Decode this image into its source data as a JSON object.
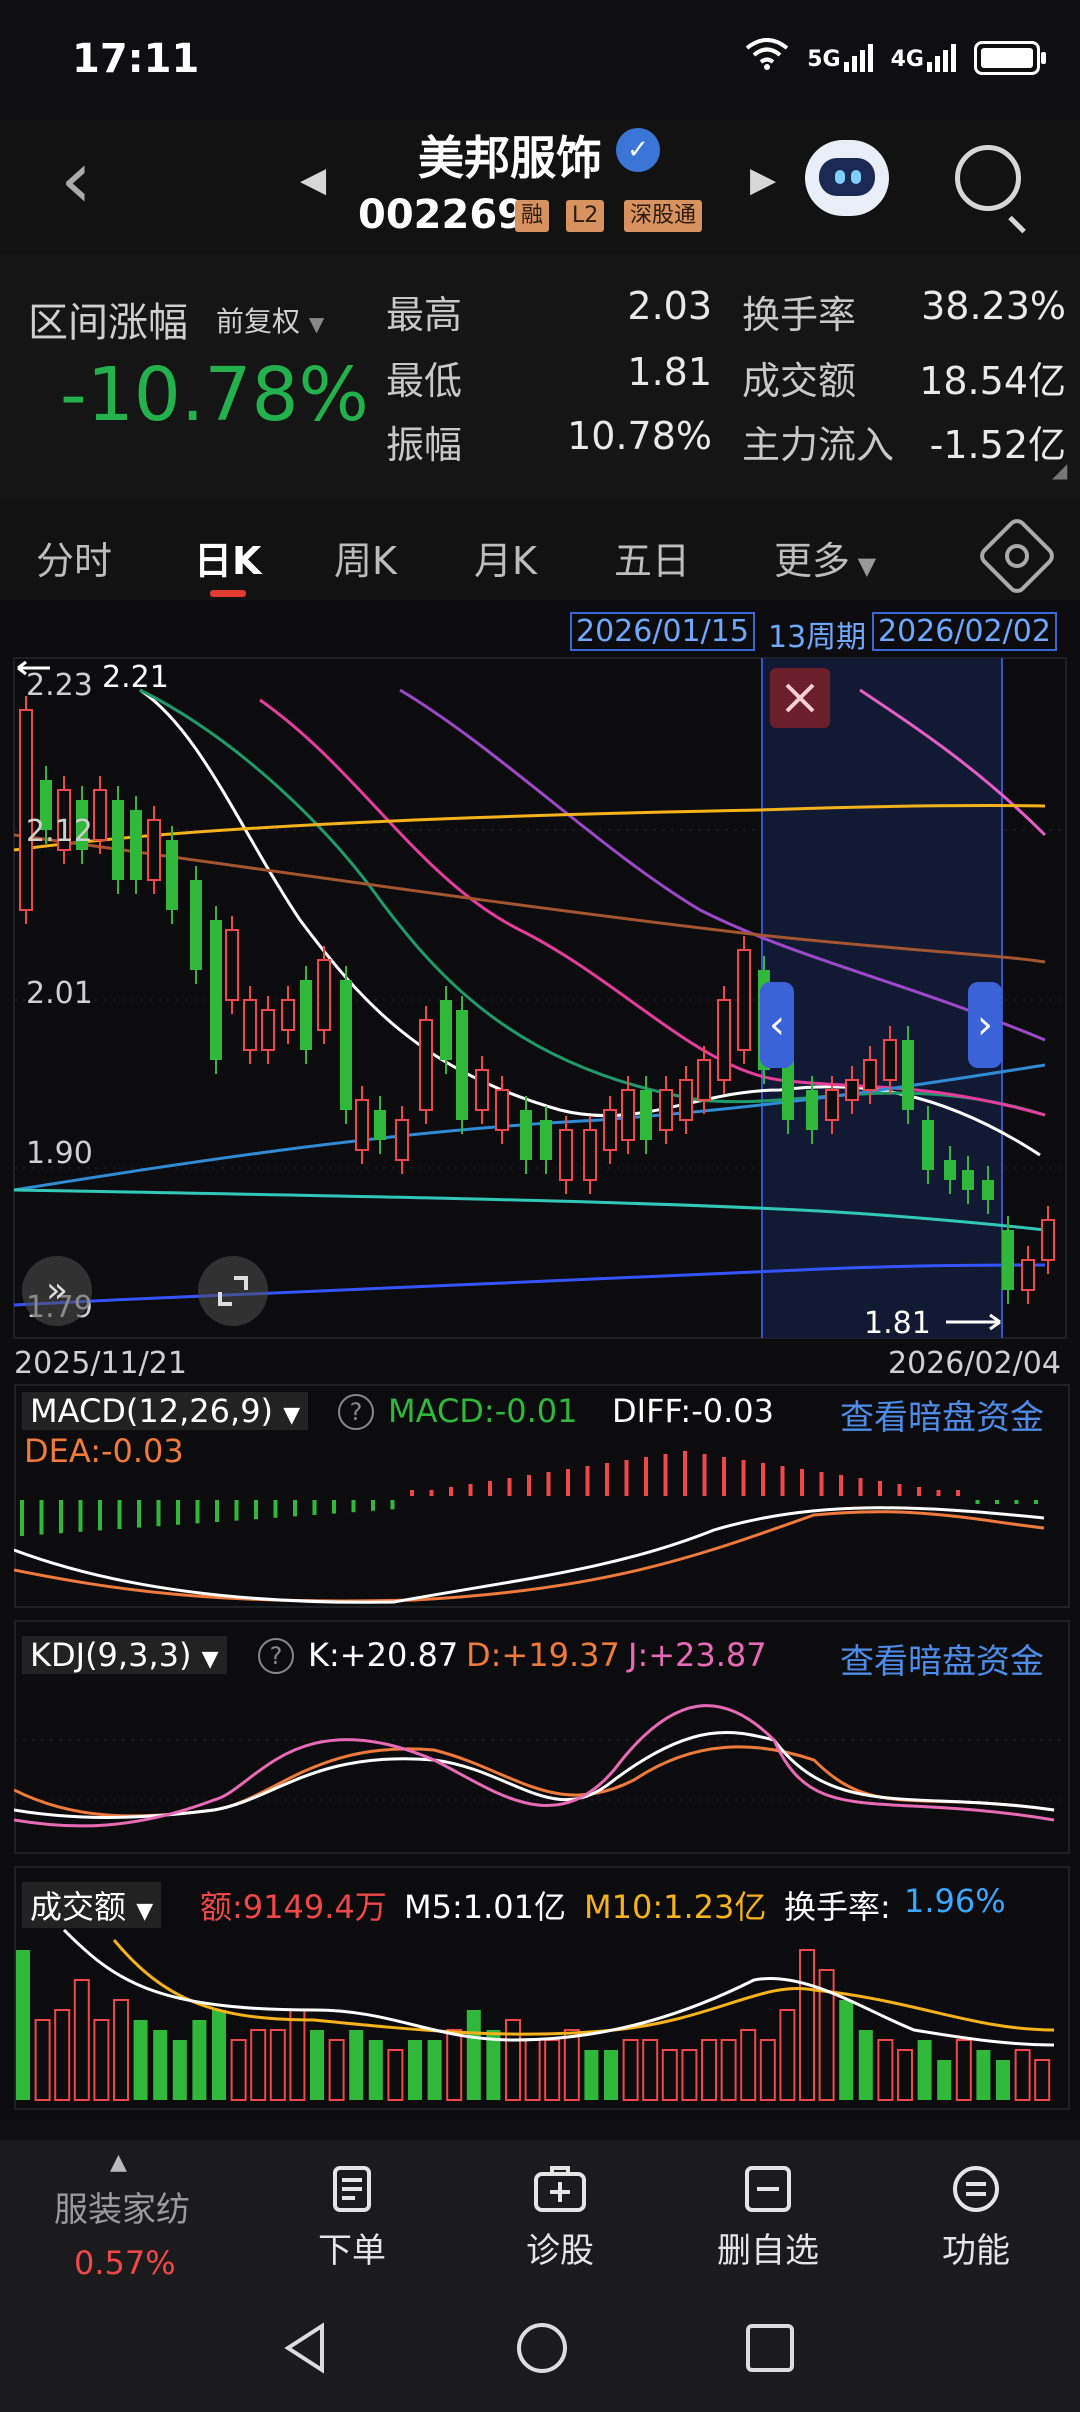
{
  "status_bar": {
    "time": "17:11",
    "net1": "5G",
    "net2": "4G"
  },
  "stock": {
    "name": "美邦服饰",
    "code": "002269",
    "tags": [
      "融",
      "L2",
      "深股通"
    ]
  },
  "quote": {
    "range_label": "区间涨幅",
    "adjust_label": "前复权",
    "range_change": "-10.78%",
    "high_label": "最高",
    "high_value": "2.03",
    "low_label": "最低",
    "low_value": "1.81",
    "amplitude_label": "振幅",
    "amplitude_value": "10.78%",
    "turnover_label": "换手率",
    "turnover_value": "38.23%",
    "amount_label": "成交额",
    "amount_value": "18.54亿",
    "inflow_label": "主力流入",
    "inflow_value": "-1.52亿"
  },
  "tabs": [
    "分时",
    "日K",
    "周K",
    "月K",
    "五日",
    "更多"
  ],
  "range_select": {
    "start": "2026/01/15",
    "period": "13周期",
    "end": "2026/02/02"
  },
  "kline": {
    "y_labels": [
      "2.23",
      "2.12",
      "2.01",
      "1.90",
      "1.79"
    ],
    "max_label": "2.21",
    "min_label": "1.81",
    "start_date": "2025/11/21",
    "end_date": "2026/02/04",
    "up_color": "#f04848",
    "down_color": "#2fb83a"
  },
  "macd": {
    "name": "MACD(12,26,9)",
    "macd": "MACD:-0.01",
    "diff": "DIFF:-0.03",
    "dea": "DEA:-0.03",
    "link": "查看暗盘资金"
  },
  "kdj": {
    "name": "KDJ(9,3,3)",
    "k": "K:+20.87",
    "d": "D:+19.37",
    "j": "J:+23.87",
    "link": "查看暗盘资金"
  },
  "volume": {
    "name": "成交额",
    "amount": "额:9149.4万",
    "m5": "M5:1.01亿",
    "m10": "M10:1.23亿",
    "turnover_label": "换手率:",
    "turnover": "1.96%"
  },
  "bottom": {
    "sector_name": "服装家纺",
    "sector_change": "0.57%",
    "items": [
      "下单",
      "诊股",
      "删自选",
      "功能"
    ]
  }
}
